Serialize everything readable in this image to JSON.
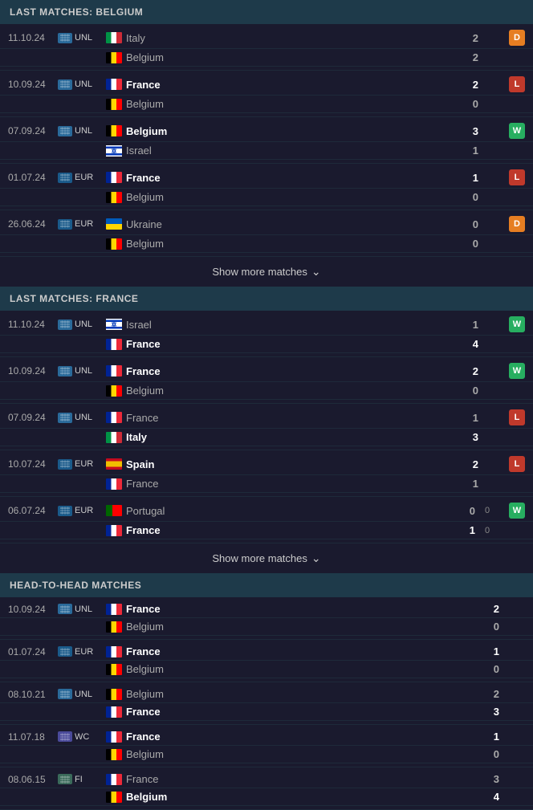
{
  "sections": [
    {
      "id": "belgium",
      "header": "LAST MATCHES: BELGIUM",
      "matches": [
        {
          "date": "11.10.24",
          "comp": "UNL",
          "teams": [
            {
              "name": "Italy",
              "flag": "italy",
              "score": "2",
              "winner": false
            },
            {
              "name": "Belgium",
              "flag": "belgium",
              "score": "2",
              "winner": false
            }
          ],
          "result": "D",
          "resultClass": "result-d"
        },
        {
          "date": "10.09.24",
          "comp": "UNL",
          "teams": [
            {
              "name": "France",
              "flag": "france",
              "score": "2",
              "winner": true
            },
            {
              "name": "Belgium",
              "flag": "belgium",
              "score": "0",
              "winner": false
            }
          ],
          "result": "L",
          "resultClass": "result-l"
        },
        {
          "date": "07.09.24",
          "comp": "UNL",
          "teams": [
            {
              "name": "Belgium",
              "flag": "belgium",
              "score": "3",
              "winner": true
            },
            {
              "name": "Israel",
              "flag": "israel",
              "score": "1",
              "winner": false
            }
          ],
          "result": "W",
          "resultClass": "result-w"
        },
        {
          "date": "01.07.24",
          "comp": "EUR",
          "teams": [
            {
              "name": "France",
              "flag": "france",
              "score": "1",
              "winner": true
            },
            {
              "name": "Belgium",
              "flag": "belgium",
              "score": "0",
              "winner": false
            }
          ],
          "result": "L",
          "resultClass": "result-l"
        },
        {
          "date": "26.06.24",
          "comp": "EUR",
          "teams": [
            {
              "name": "Ukraine",
              "flag": "ukraine",
              "score": "0",
              "winner": false
            },
            {
              "name": "Belgium",
              "flag": "belgium",
              "score": "0",
              "winner": false
            }
          ],
          "result": "D",
          "resultClass": "result-d"
        }
      ],
      "show_more": "Show more matches"
    },
    {
      "id": "france",
      "header": "LAST MATCHES: FRANCE",
      "matches": [
        {
          "date": "11.10.24",
          "comp": "UNL",
          "teams": [
            {
              "name": "Israel",
              "flag": "israel",
              "score": "1",
              "winner": false
            },
            {
              "name": "France",
              "flag": "france",
              "score": "4",
              "winner": true
            }
          ],
          "result": "W",
          "resultClass": "result-w"
        },
        {
          "date": "10.09.24",
          "comp": "UNL",
          "teams": [
            {
              "name": "France",
              "flag": "france",
              "score": "2",
              "winner": true
            },
            {
              "name": "Belgium",
              "flag": "belgium",
              "score": "0",
              "winner": false
            }
          ],
          "result": "W",
          "resultClass": "result-w"
        },
        {
          "date": "07.09.24",
          "comp": "UNL",
          "teams": [
            {
              "name": "France",
              "flag": "france",
              "score": "1",
              "winner": false
            },
            {
              "name": "Italy",
              "flag": "italy",
              "score": "3",
              "winner": true
            }
          ],
          "result": "L",
          "resultClass": "result-l"
        },
        {
          "date": "10.07.24",
          "comp": "EUR",
          "teams": [
            {
              "name": "Spain",
              "flag": "spain",
              "score": "2",
              "winner": true
            },
            {
              "name": "France",
              "flag": "france",
              "score": "1",
              "winner": false
            }
          ],
          "result": "L",
          "resultClass": "result-l"
        },
        {
          "date": "06.07.24",
          "comp": "EUR",
          "teams": [
            {
              "name": "Portugal",
              "flag": "portugal",
              "score": "0",
              "winner": false,
              "extra": "0"
            },
            {
              "name": "France",
              "flag": "france",
              "score": "1",
              "winner": true,
              "extra": "0"
            }
          ],
          "result": "W",
          "resultClass": "result-w"
        }
      ],
      "show_more": "Show more matches"
    },
    {
      "id": "h2h",
      "header": "HEAD-TO-HEAD MATCHES",
      "matches": [
        {
          "date": "10.09.24",
          "comp": "UNL",
          "teams": [
            {
              "name": "France",
              "flag": "france",
              "score": "2",
              "winner": true
            },
            {
              "name": "Belgium",
              "flag": "belgium",
              "score": "0",
              "winner": false
            }
          ],
          "result": null
        },
        {
          "date": "01.07.24",
          "comp": "EUR",
          "teams": [
            {
              "name": "France",
              "flag": "france",
              "score": "1",
              "winner": true
            },
            {
              "name": "Belgium",
              "flag": "belgium",
              "score": "0",
              "winner": false
            }
          ],
          "result": null
        },
        {
          "date": "08.10.21",
          "comp": "UNL",
          "teams": [
            {
              "name": "Belgium",
              "flag": "belgium",
              "score": "2",
              "winner": false
            },
            {
              "name": "France",
              "flag": "france",
              "score": "3",
              "winner": true
            }
          ],
          "result": null
        },
        {
          "date": "11.07.18",
          "comp": "WC",
          "teams": [
            {
              "name": "France",
              "flag": "france",
              "score": "1",
              "winner": true
            },
            {
              "name": "Belgium",
              "flag": "belgium",
              "score": "0",
              "winner": false
            }
          ],
          "result": null
        },
        {
          "date": "08.06.15",
          "comp": "FI",
          "teams": [
            {
              "name": "France",
              "flag": "france",
              "score": "3",
              "winner": false
            },
            {
              "name": "Belgium",
              "flag": "belgium",
              "score": "4",
              "winner": true
            }
          ],
          "result": null
        }
      ],
      "show_more": null
    }
  ]
}
